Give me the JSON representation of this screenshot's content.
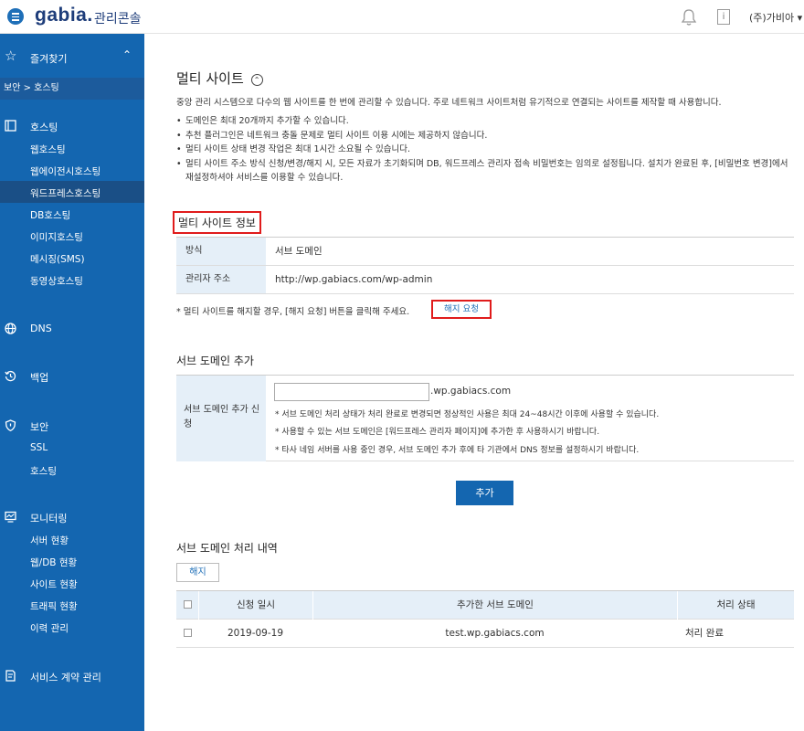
{
  "header": {
    "logo": "gabia.",
    "logo_sub": "관리콘솔",
    "info_icon_glyph": "i",
    "user": "(주)가비아"
  },
  "sidebar": {
    "favorites": "즐겨찾기",
    "breadcrumb": "보안 > 호스팅",
    "sections": [
      {
        "label": "호스팅",
        "icon": "server-icon",
        "items": [
          "웹호스팅",
          "웹에이전시호스팅",
          "워드프레스호스팅",
          "DB호스팅",
          "이미지호스팅",
          "메시징(SMS)",
          "동영상호스팅"
        ]
      },
      {
        "label": "DNS",
        "icon": "globe-icon",
        "items": []
      },
      {
        "label": "백업",
        "icon": "backup-icon",
        "items": []
      },
      {
        "label": "보안",
        "icon": "shield-icon",
        "items": [
          "SSL",
          "호스팅"
        ]
      },
      {
        "label": "모니터링",
        "icon": "monitor-icon",
        "items": [
          "서버 현황",
          "웹/DB 현황",
          "사이트 현황",
          "트래픽 현황",
          "이력 관리"
        ]
      },
      {
        "label": "서비스 계약 관리",
        "icon": "contract-icon",
        "items": []
      }
    ],
    "active_item": "워드프레스호스팅"
  },
  "page": {
    "title": "멀티 사이트",
    "intro": "중앙 관리 시스템으로 다수의 웹 사이트를 한 번에 관리할 수 있습니다. 주로 네트워크 사이트처럼 유기적으로 연결되는 사이트를 제작할 때 사용합니다.",
    "bullets": [
      "도메인은 최대 20개까지 추가할 수 있습니다.",
      "추천 플러그인은 네트워크 충돌 문제로 멀티 사이트 이용 시에는 제공하지 않습니다.",
      "멀티 사이트 상태 변경 작업은 최대 1시간 소요될 수 있습니다.",
      "멀티 사이트 주소 방식 신청/변경/해지 시, 모든 자료가 초기화되며 DB, 워드프레스 관리자 접속 비밀번호는 임의로 설정됩니다. 설치가 완료된 후, [비밀번호 변경]에서 재설정하셔야 서비스를 이용할 수 있습니다."
    ]
  },
  "multi_info": {
    "title": "멀티 사이트 정보",
    "rows": [
      {
        "key": "방식",
        "value": "서브 도메인"
      },
      {
        "key": "관리자 주소",
        "value": "http://wp.gabiacs.com/wp-admin"
      }
    ],
    "note": "* 멀티 사이트를 해지할 경우, [해지 요청] 버튼을 클릭해 주세요.",
    "cancel_button": "해지 요청"
  },
  "subdomain_add": {
    "title": "서브 도메인 추가",
    "label": "서브 도메인 추가 신청",
    "input_value": "",
    "suffix": ".wp.gabiacs.com",
    "notes": [
      "* 서브 도메인 처리 상태가 처리 완료로 변경되면 정상적인 사용은 최대 24~48시간 이후에 사용할 수 있습니다.",
      "* 사용할 수 있는 서브 도메인은 [워드프레스 관리자 페이지]에 추가한 후 사용하시기 바랍니다.",
      "* 타사 네임 서버를 사용 중인 경우, 서브 도메인 추가 후에 타 기관에서 DNS 정보를 설정하시기 바랍니다."
    ],
    "add_button": "추가"
  },
  "history": {
    "title": "서브 도메인 처리 내역",
    "delete_button": "해지",
    "columns": [
      "신청 일시",
      "추가한 서브 도메인",
      "처리 상태"
    ],
    "rows": [
      {
        "date": "2019-09-19",
        "domain": "test.wp.gabiacs.com",
        "status": "처리 완료"
      }
    ]
  },
  "colors": {
    "accent": "#1466b0",
    "highlight": "#e01b1b"
  }
}
